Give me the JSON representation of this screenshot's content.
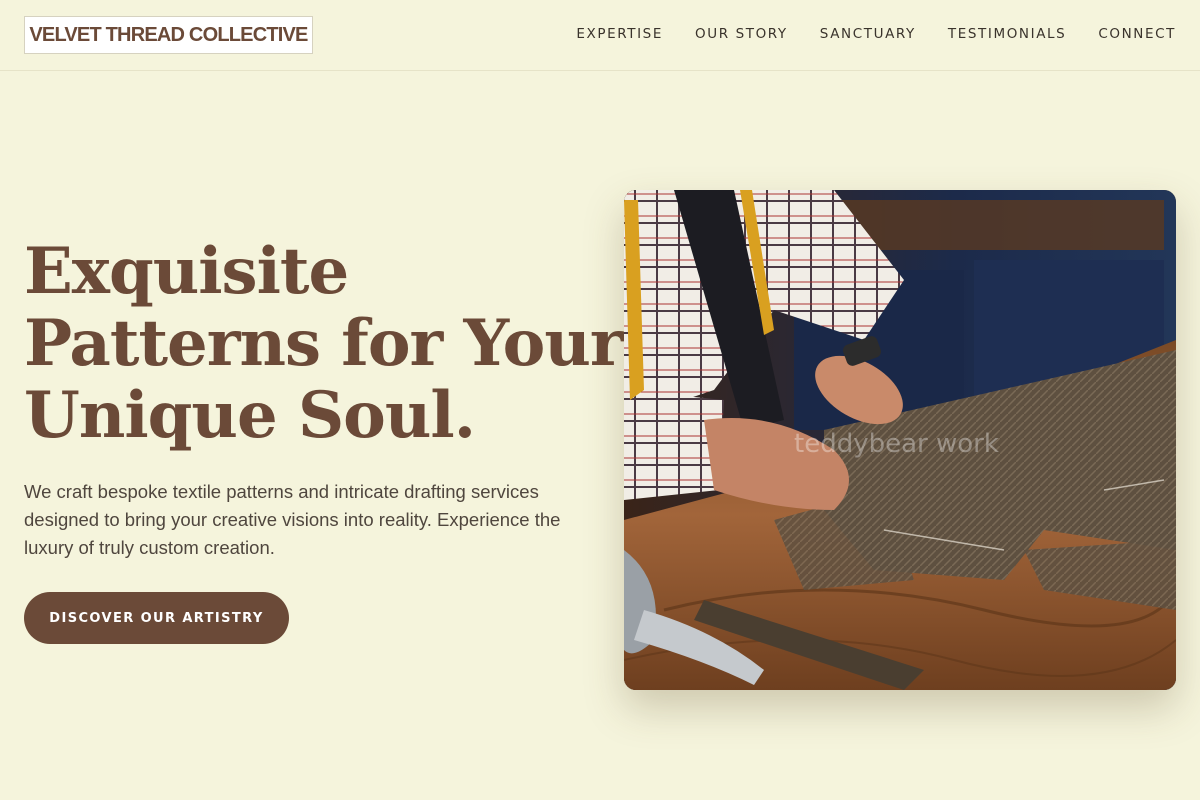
{
  "brand": {
    "name": "VELVET THREAD COLLECTIVE"
  },
  "nav": {
    "items": [
      {
        "label": "EXPERTISE"
      },
      {
        "label": "OUR STORY"
      },
      {
        "label": "SANCTUARY"
      },
      {
        "label": "TESTIMONIALS"
      },
      {
        "label": "CONNECT"
      }
    ]
  },
  "hero": {
    "title_lines": [
      "Exquisite",
      "Patterns for Your",
      "Unique Soul."
    ],
    "description": "We craft bespoke textile patterns and intricate drafting services designed to bring your creative visions into reality. Experience the luxury of truly custom creation.",
    "cta_label": "DISCOVER OUR ARTISTRY",
    "image_watermark": "teddybear work"
  },
  "colors": {
    "background": "#f5f4dc",
    "accent": "#6b4a38",
    "text": "#4f463e"
  }
}
